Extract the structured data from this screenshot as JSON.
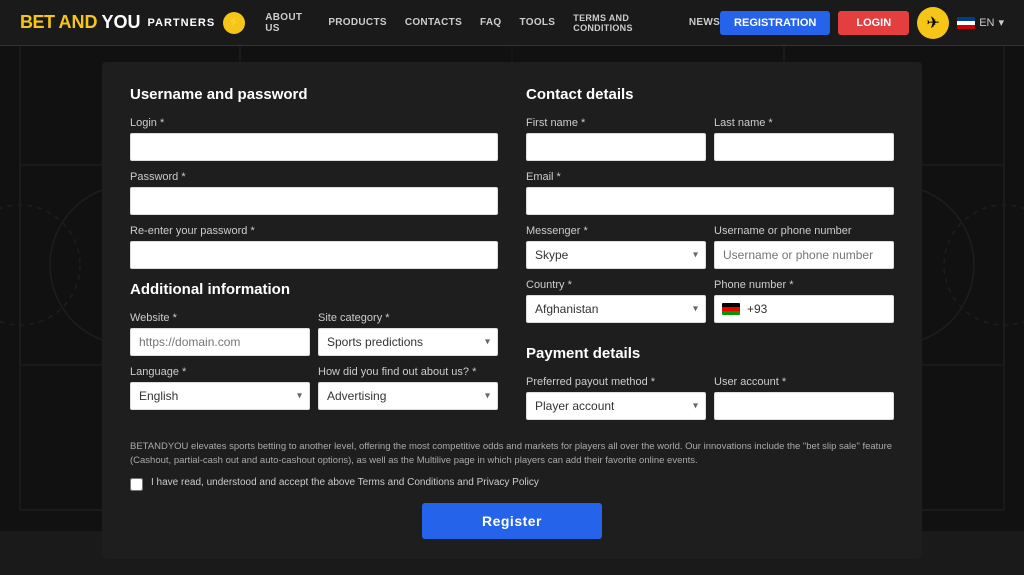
{
  "brand": {
    "bet": "BET",
    "and": "AND",
    "you": "YOU",
    "partners": "PARTNERS"
  },
  "nav": {
    "about_us": "ABOUT US",
    "products": "PRODUCTS",
    "contacts": "CONTACTS",
    "faq": "FAQ",
    "tools": "TOOLS",
    "terms": "TERMS AND CONDITIONS",
    "news": "NEWS",
    "registration": "REGISTRATION",
    "login": "LOGIN",
    "lang": "EN"
  },
  "form": {
    "username_section_title": "Username and password",
    "contact_section_title": "Contact details",
    "additional_section_title": "Additional information",
    "payment_section_title": "Payment details",
    "login_label": "Login *",
    "password_label": "Password *",
    "reenter_password_label": "Re-enter your password *",
    "first_name_label": "First name *",
    "last_name_label": "Last name *",
    "email_label": "Email *",
    "messenger_label": "Messenger *",
    "messenger_default": "Skype",
    "username_phone_label": "Username or phone number",
    "username_phone_placeholder": "Username or phone number",
    "country_label": "Country *",
    "country_default": "Afghanistan",
    "phone_label": "Phone number *",
    "phone_prefix": "+93",
    "website_label": "Website *",
    "website_placeholder": "https://domain.com",
    "site_category_label": "Site category *",
    "site_category_default": "Sports predictions",
    "language_label": "Language *",
    "language_default": "English",
    "how_label": "How did you find out about us? *",
    "how_default": "Advertising",
    "payout_label": "Preferred payout method *",
    "payout_default": "Player account",
    "user_account_label": "User account *",
    "terms_text": "BETANDYOU elevates sports betting to another level, offering the most competitive odds and markets for players all over the world. Our innovations include the \"bet slip sale\" feature (Cashout, partial-cash out and auto-cashout options), as well as the Multilive page in which players can add their favorite online events.",
    "checkbox_label": "I have read, understood and accept the above Terms and Conditions and Privacy Policy",
    "register_btn": "Register"
  }
}
